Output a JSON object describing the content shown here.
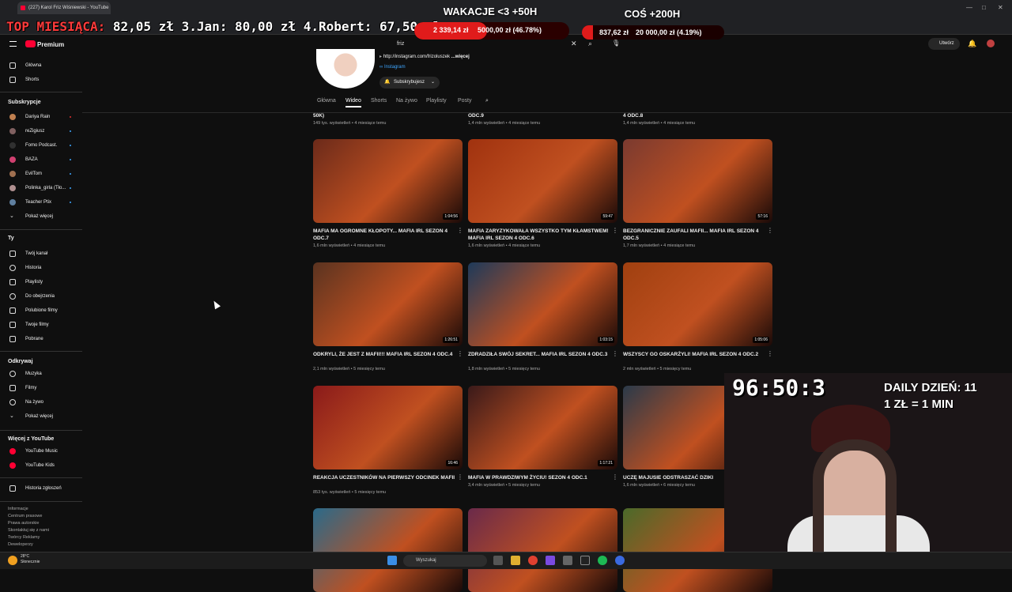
{
  "browser": {
    "tab_title": "(227) Karol Friz Wiśniewski - YouTube",
    "window_controls": [
      "—",
      "□",
      "✕"
    ]
  },
  "overlay": {
    "top_label": "TOP MIESIĄCA:",
    "top_list": "82,05 zł  3.Jan: 80,00 zł  4.Robert: 67,50 zł",
    "goal1_title": "WAKACJE <3 +50H",
    "goal1_current": "2 339,14 zł",
    "goal1_target": "5000,00 zł (46.78%)",
    "goal1_progress": 0.4678,
    "goal2_title": "COŚ +200H",
    "goal2_current": "837,62 zł",
    "goal2_target": "20 000,00 zł (4.19%)",
    "goal2_progress": 0.0419,
    "timer": "96:50:3",
    "daily_line1": "DAILY DZIEŃ: 11",
    "daily_line2": "1 ZŁ = 1 MIN"
  },
  "youtube": {
    "logo": "Premium",
    "search_value": "friz",
    "create_label": "Utwórz"
  },
  "sidebar": {
    "main": [
      "Główna",
      "Shorts"
    ],
    "subs_header": "Subskrypcje",
    "subs": [
      "Dariya Rain",
      "reZigiusz",
      "Fomo Podcast.",
      "BAZA",
      "EvilTom",
      "Polinka_girla (Tło...",
      "Teacher Ptix",
      "Pokaż więcej"
    ],
    "you_header": "Ty",
    "you": [
      "Twój kanał",
      "Historia",
      "Playlisty",
      "Do obejrzenia",
      "Polubione filmy",
      "Twoje filmy",
      "Pobrane"
    ],
    "explore_header": "Odkrywaj",
    "explore": [
      "Muzyka",
      "Filmy",
      "Na żywo",
      "Pokaż więcej"
    ],
    "more_header": "Więcej z YouTube",
    "more": [
      "YouTube Music",
      "YouTube Kids"
    ],
    "report": "Historia zgłoszeń",
    "footer": [
      "Informacje",
      "Centrum prasowe",
      "Prawa autorskie",
      "Skontaktuj się z nami",
      "Twórcy  Reklamy",
      "Deweloperzy"
    ]
  },
  "channel": {
    "link": "http://instagram.com/frizoluszek",
    "more": "...więcej",
    "instagram": "Instagram",
    "subscribed": "Subskrybujesz",
    "tabs": [
      "Główna",
      "Wideo",
      "Shorts",
      "Na żywo",
      "Playlisty",
      "Posty"
    ]
  },
  "videos_prev_row": [
    {
      "title": "50k)",
      "meta": "149 tys. wyświetleń • 4 miesiące temu"
    },
    {
      "title": "odc.9",
      "meta": "1,4 mln wyświetleń • 4 miesiące temu"
    },
    {
      "title": "4 odc.8",
      "meta": "1,4 mln wyświetleń • 4 miesiące temu"
    }
  ],
  "videos": [
    {
      "title": "MAFIA MA OGROMNE KŁOPOTY... MAFIA IRL SEZON 4 odc.7",
      "meta": "1,6 mln wyświetleń • 4 miesiące temu",
      "duration": "1:04:56",
      "color": "#6b2a1a"
    },
    {
      "title": "MAFIA ZARYZYKOWAŁA WSZYSTKO TYM KŁAMSTWEM! MAFIA IRL SEZON 4 odc.6",
      "meta": "1,6 mln wyświetleń • 4 miesiące temu",
      "duration": "59:47",
      "color": "#a0320f"
    },
    {
      "title": "BEZGRANICZNIE ZAUFALI MAFII... MAFIA IRL SEZON 4 odc.5",
      "meta": "1,7 mln wyświetleń • 4 miesiące temu",
      "duration": "57:16",
      "color": "#7a3a30"
    },
    {
      "title": "ODKRYLI, ŻE JEST Z MAFII!!! MAFIA IRL SEZON 4 odc.4",
      "meta": "2,1 mln wyświetleń • 5 miesięcy temu",
      "duration": "1:26:51",
      "color": "#5a3320"
    },
    {
      "title": "ZDRADZIŁA SWÓJ SEKRET... MAFIA IRL SEZON 4 odc.3",
      "meta": "1,8 mln wyświetleń • 5 miesięcy temu",
      "duration": "1:03:15",
      "color": "#1e3a5a"
    },
    {
      "title": "WSZYSCY GO OSKARŻYLI! MAFIA IRL SEZON 4 odc.2",
      "meta": "2 mln wyświetleń • 5 miesięcy temu",
      "duration": "1:05:06",
      "color": "#a04010"
    },
    {
      "title": "REAKCJA UCZESTNIKÓW NA PIERWSZY ODCINEK MAFII",
      "meta": "853 tys. wyświetleń • 5 miesięcy temu",
      "duration": "16:46",
      "color": "#8a1a1a"
    },
    {
      "title": "MAFIA W PRAWDZIWYM ŻYCIU! SEZON 4 odc.1",
      "meta": "3,4 mln wyświetleń • 5 miesięcy temu",
      "duration": "1:17:21",
      "color": "#3a1a1a"
    },
    {
      "title": "UCZĘ MAJUSIE ODSTRASZAĆ DZIKI",
      "meta": "1,6 mln wyświetleń • 6 miesięcy temu",
      "duration": "",
      "color": "#2a3a4a"
    },
    {
      "title": "",
      "meta": "",
      "duration": "",
      "color": "#2a6a8a"
    },
    {
      "title": "",
      "meta": "",
      "duration": "",
      "color": "#6a2a4a"
    },
    {
      "title": "",
      "meta": "",
      "duration": "",
      "color": "#4a6a2a"
    }
  ],
  "taskbar": {
    "weather_temp": "28°C",
    "weather_desc": "Słonecznie",
    "search": "Wyszukaj"
  }
}
